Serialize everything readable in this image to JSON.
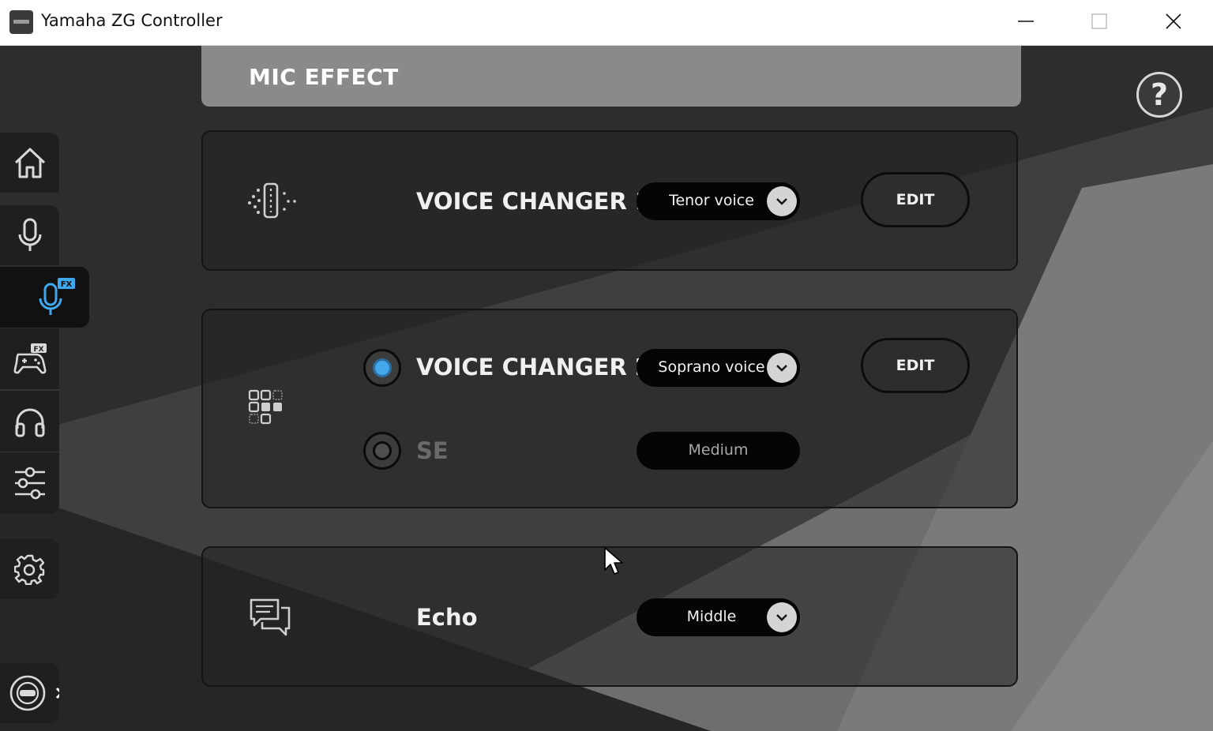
{
  "window": {
    "title": "Yamaha ZG Controller",
    "controls": [
      "minimize",
      "maximize",
      "close"
    ]
  },
  "header": {
    "title": "MIC EFFECT"
  },
  "help": {
    "label": "?"
  },
  "sidebar": {
    "items": [
      {
        "icon": "home-icon"
      },
      {
        "icon": "microphone-icon"
      },
      {
        "icon": "microphone-fx-icon",
        "badge": "FX",
        "active": true
      },
      {
        "icon": "gamepad-fx-icon",
        "badge": "FX"
      },
      {
        "icon": "headphones-icon"
      },
      {
        "icon": "mixer-sliders-icon"
      },
      {
        "icon": "gear-icon"
      },
      {
        "icon": "device-icon"
      }
    ]
  },
  "effects": {
    "voice_changer_1": {
      "label": "VOICE CHANGER 1",
      "icon": "voice-changer-icon",
      "value": "Tenor voice",
      "edit_label": "EDIT"
    },
    "voice_changer_2": {
      "label": "VOICE CHANGER 2",
      "icon": "grid-effect-icon",
      "value": "Soprano voice",
      "edit_label": "EDIT",
      "selected": true
    },
    "se": {
      "label": "SE",
      "value": "Medium",
      "selected": false
    },
    "echo": {
      "label": "Echo",
      "icon": "chat-bubbles-icon",
      "value": "Middle"
    }
  },
  "colors": {
    "accent": "#43a9ec",
    "titlebar": "#ffffff",
    "background": "#2d2d2d",
    "header_panel": "#8a8a8a"
  }
}
